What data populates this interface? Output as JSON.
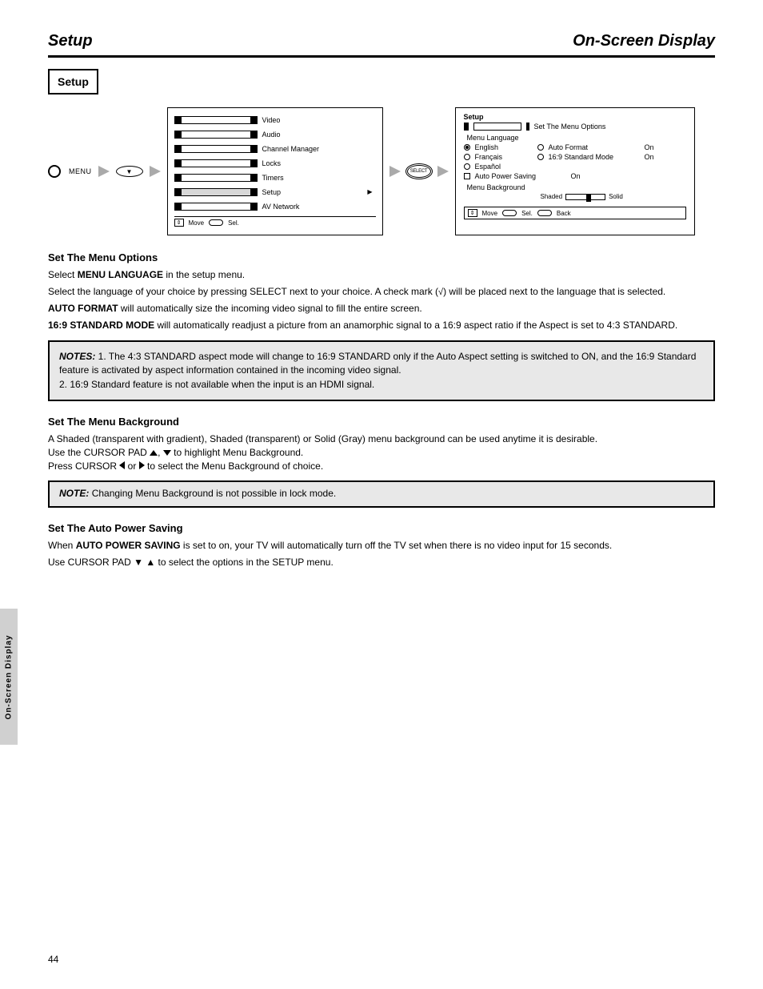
{
  "header": {
    "left": "Setup",
    "right": "On-Screen Display"
  },
  "box_label": "Setup",
  "menu": {
    "items": [
      {
        "label": "Video"
      },
      {
        "label": "Audio"
      },
      {
        "label": "Channel Manager"
      },
      {
        "label": "Locks"
      },
      {
        "label": "Timers"
      },
      {
        "label": "Setup",
        "highlighted": true
      },
      {
        "label": "AV Network"
      }
    ],
    "footer_label1": "Move",
    "footer_label2": "Sel."
  },
  "setup_panel": {
    "title": "Setup",
    "section": "Set The Menu Options",
    "language_label": "Menu Language",
    "lang_options": [
      {
        "name": "English",
        "checked": true,
        "extra_label": "Auto Format",
        "extra_val": "On"
      },
      {
        "name": "Français",
        "checked": false,
        "extra_label": "16:9 Standard Mode",
        "extra_val": "On"
      },
      {
        "name": "Español",
        "checked": false
      }
    ],
    "auto_power_label": "Auto Power Saving",
    "auto_power_val": "On",
    "bg_label": "Menu Background",
    "bg_min": "Shaded",
    "bg_max": "Solid",
    "footer": {
      "move": "Move",
      "sel": "Sel.",
      "back": "Back"
    }
  },
  "lang_section": {
    "title": "Set The Menu Options",
    "line1_pre": "Select",
    "line1_mid": "MENU LANGUAGE",
    "line1_post": "in the setup menu.",
    "line2": "Select the language of your choice by pressing SELECT next to your choice. A check mark (   ) will be placed next to the language that is selected.",
    "line3_bold": "AUTO FORMAT ",
    "line3_rest": "will automatically size the incoming video signal to fill the entire screen.",
    "line4_bold": "16:9 STANDARD MODE ",
    "line4_rest": "will automatically readjust a picture from an anamorphic signal to a 16:9 aspect ratio if the Aspect is set to 4:3 STANDARD.",
    "note_label": "NOTES: ",
    "note1": "1. The 4:3 STANDARD aspect mode will change to 16:9 STANDARD only if the Auto Aspect setting is switched to ON, and the 16:9 Standard feature is activated by aspect information contained in the incoming video signal.",
    "note2": "2. 16:9 Standard feature is not available when the input is an HDMI signal."
  },
  "bg_section": {
    "title": "Set The Menu Background",
    "text_pre": "A Shaded (transparent with gradient), Shaded (transparent) or Solid (Gray) menu background can be used anytime it is desirable.\nUse the CURSOR PAD ",
    "text_mid": " to highlight Menu Background.",
    "text_post": "Press CURSOR     or     to select the Menu Background of choice.",
    "note_label": "NOTE:",
    "note": "Changing Menu Background is not possible in lock mode."
  },
  "power_section": {
    "title": "Set The Auto Power Saving",
    "text1_pre": "When ",
    "text1_b": "AUTO POWER SAVING",
    "text1_post": " is set to on, your TV will automatically turn off the TV set when there is no video input for 15 seconds.",
    "text2": "Use CURSOR PAD ▼ ▲ to select the options in the SETUP menu."
  },
  "side_tab": "On-Screen Display",
  "page_number": "44"
}
